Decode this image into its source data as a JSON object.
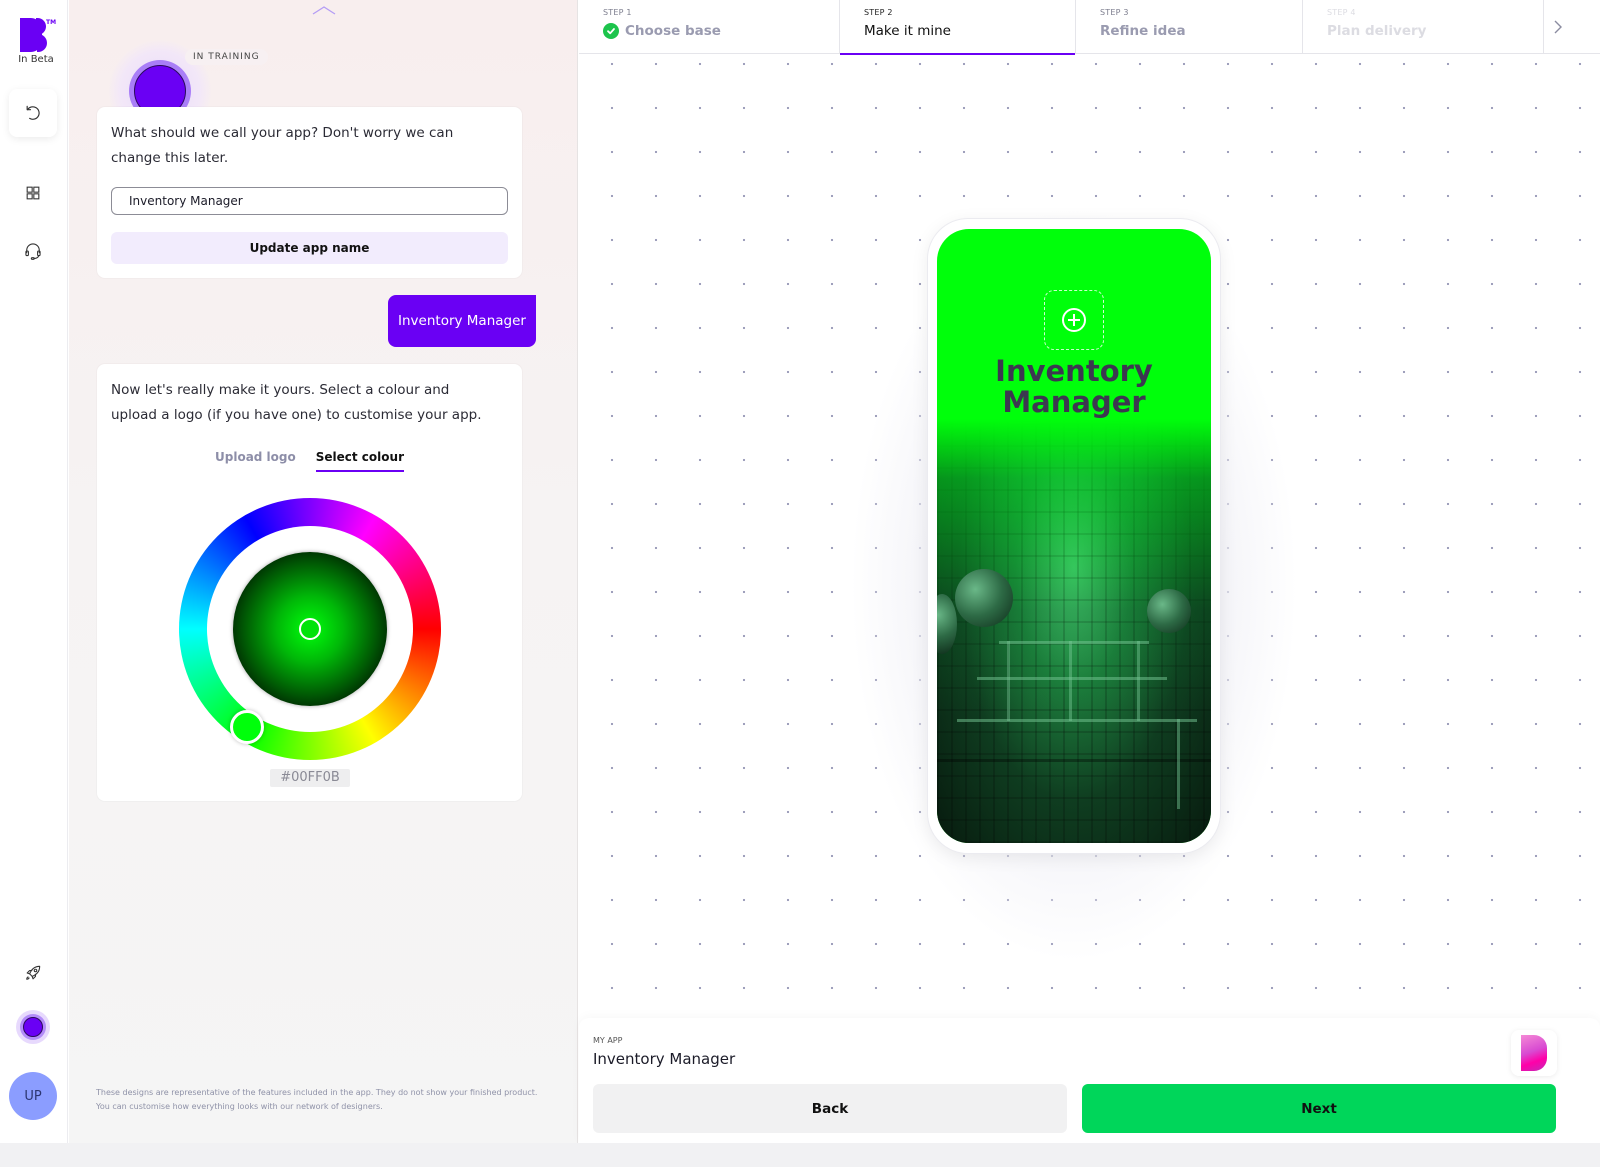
{
  "rail": {
    "logo_text": "In Beta",
    "logo_tm": "TM",
    "items": [
      {
        "name": "undo",
        "icon": "undo-icon"
      },
      {
        "name": "grid",
        "icon": "grid-icon"
      },
      {
        "name": "support",
        "icon": "headset-icon"
      },
      {
        "name": "launch",
        "icon": "rocket-icon"
      },
      {
        "name": "assistant",
        "icon": "assistant-orb-icon"
      }
    ],
    "avatar_initials": "UP"
  },
  "chat": {
    "assistant_badge": "IN TRAINING",
    "name_prompt": "What should we call your app? Don't worry we can change this later.",
    "name_input_value": "Inventory Manager",
    "update_button": "Update app name",
    "user_reply": "Inventory Manager",
    "customise_prompt": "Now let's really make it yours. Select a colour and upload a logo (if you have one) to customise your app.",
    "tabs": [
      {
        "label": "Upload logo",
        "active": false
      },
      {
        "label": "Select colour",
        "active": true
      }
    ],
    "selected_colour_hex": "#00FF0B",
    "disclaimer_line1": "These designs are representative of the features included in the app. They do not show your finished product.",
    "disclaimer_line2": "You can customise how everything looks with our network of designers."
  },
  "steps": [
    {
      "num": "STEP 1",
      "label": "Choose base",
      "state": "done"
    },
    {
      "num": "STEP 2",
      "label": "Make it mine",
      "state": "current"
    },
    {
      "num": "STEP 3",
      "label": "Refine idea",
      "state": "upcoming"
    },
    {
      "num": "STEP 4",
      "label": "Plan delivery",
      "state": "disabled"
    }
  ],
  "preview": {
    "app_title_line1": "Inventory",
    "app_title_line2": "Manager",
    "brand_colour": "#00FF0B"
  },
  "footer": {
    "my_app_label": "MY APP",
    "my_app_name": "Inventory Manager",
    "back_label": "Back",
    "next_label": "Next"
  },
  "colors": {
    "accent": "#6A00F4",
    "success": "#1DC44C",
    "next_button": "#00D65A"
  }
}
